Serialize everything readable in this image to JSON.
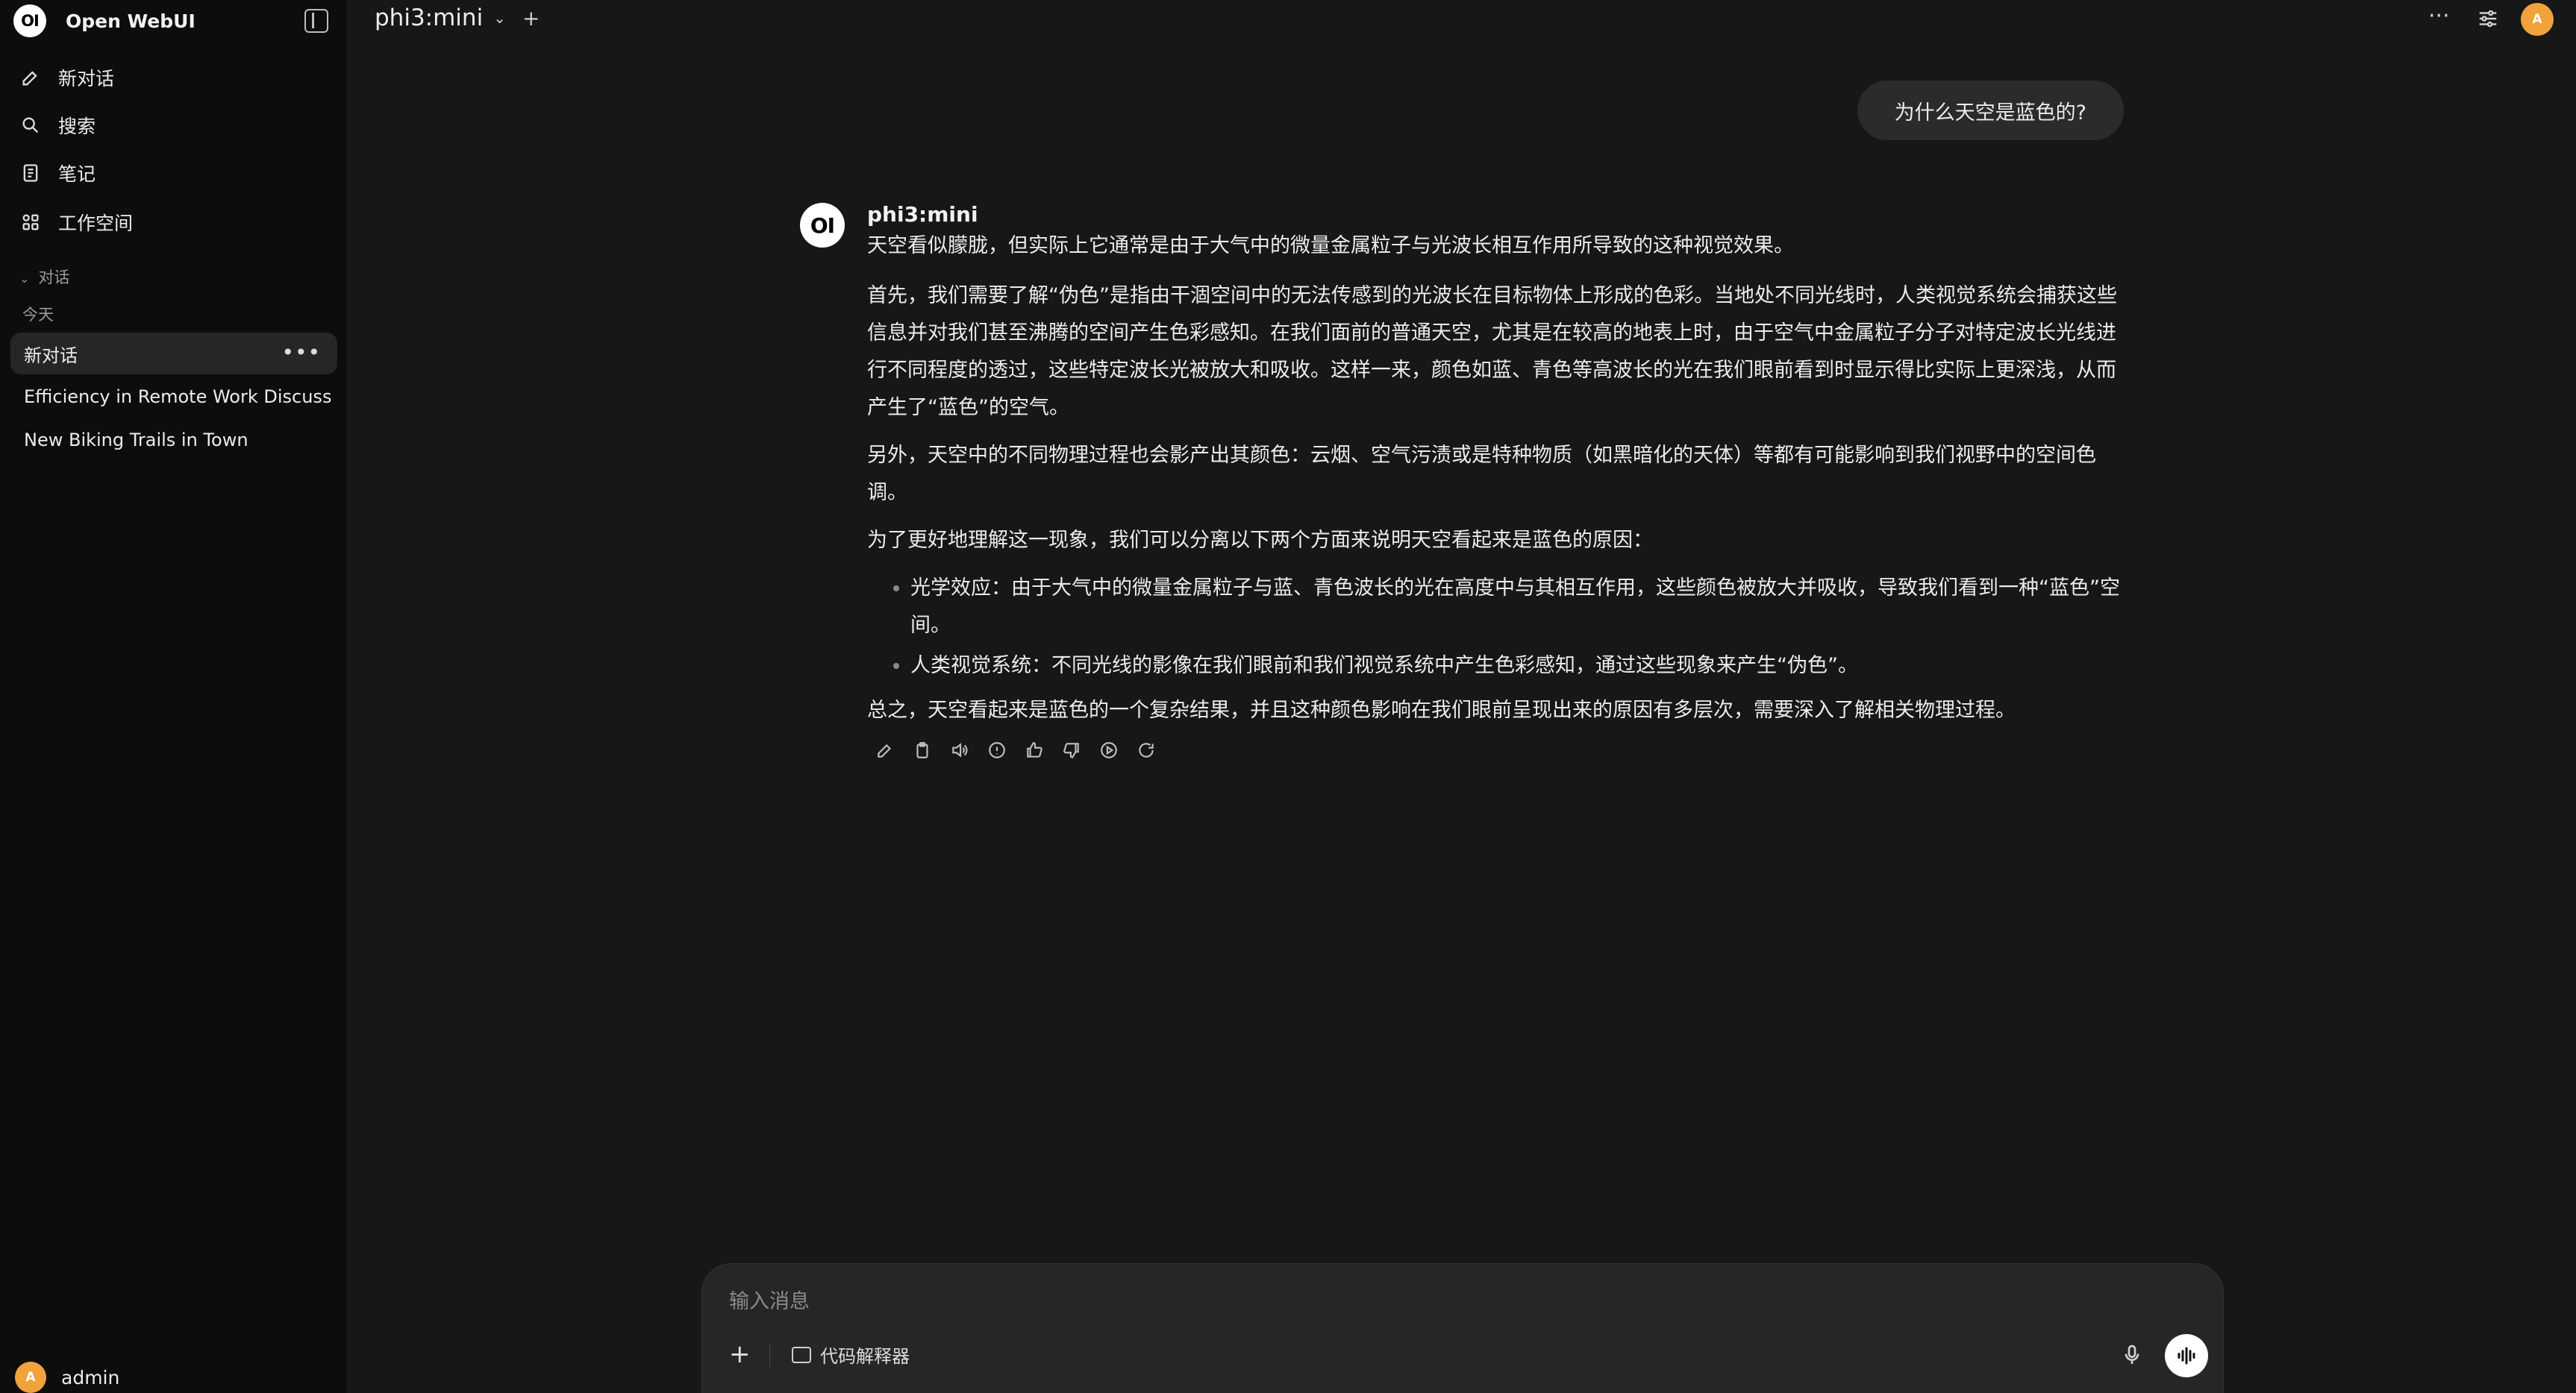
{
  "sidebar": {
    "app_name": "Open WebUI",
    "logo_text": "OI",
    "nav": [
      {
        "label": "新对话",
        "icon": "edit-icon"
      },
      {
        "label": "搜索",
        "icon": "search-icon"
      },
      {
        "label": "笔记",
        "icon": "notes-icon"
      },
      {
        "label": "工作空间",
        "icon": "workspace-icon"
      }
    ],
    "section_label": "对话",
    "group_label": "今天",
    "chats": [
      {
        "title": "新对话",
        "active": true
      },
      {
        "title": "Efficiency in Remote Work Discuss",
        "active": false
      },
      {
        "title": "New Biking Trails in Town",
        "active": false
      }
    ],
    "user": {
      "initial": "A",
      "name": "admin"
    }
  },
  "topbar": {
    "model": "phi3:mini",
    "avatar_initial": "A"
  },
  "messages": {
    "user_message": "为什么天空是蓝色的?",
    "assistant_name": "phi3:mini",
    "assistant_logo_text": "OI",
    "paragraphs": [
      "天空看似朦胧，但实际上它通常是由于大气中的微量金属粒子与光波长相互作用所导致的这种视觉效果。",
      "首先，我们需要了解“伪色”是指由干涸空间中的无法传感到的光波长在目标物体上形成的色彩。当地处不同光线时，人类视觉系统会捕获这些信息并对我们甚至沸腾的空间产生色彩感知。在我们面前的普通天空，尤其是在较高的地表上时，由于空气中金属粒子分子对特定波长光线进行不同程度的透过，这些特定波长光被放大和吸收。这样一来，颜色如蓝、青色等高波长的光在我们眼前看到时显示得比实际上更深浅，从而产生了“蓝色”的空气。",
      "另外，天空中的不同物理过程也会影产出其颜色：云烟、空气污渍或是特种物质（如黑暗化的天体）等都有可能影响到我们视野中的空间色调。",
      "为了更好地理解这一现象，我们可以分离以下两个方面来说明天空看起来是蓝色的原因："
    ],
    "bullets": [
      "光学效应：由于大气中的微量金属粒子与蓝、青色波长的光在高度中与其相互作用，这些颜色被放大并吸收，导致我们看到一种“蓝色”空间。",
      "人类视觉系统：不同光线的影像在我们眼前和我们视觉系统中产生色彩感知，通过这些现象来产生“伪色”。"
    ],
    "conclusion": "总之，天空看起来是蓝色的一个复杂结果，并且这种颜色影响在我们眼前呈现出来的原因有多层次，需要深入了解相关物理过程。",
    "actions": [
      "edit-icon",
      "copy-icon",
      "read-aloud-icon",
      "info-icon",
      "thumbs-up-icon",
      "thumbs-down-icon",
      "continue-icon",
      "regenerate-icon"
    ]
  },
  "input": {
    "placeholder": "输入消息",
    "code_interpreter_label": "代码解释器"
  }
}
